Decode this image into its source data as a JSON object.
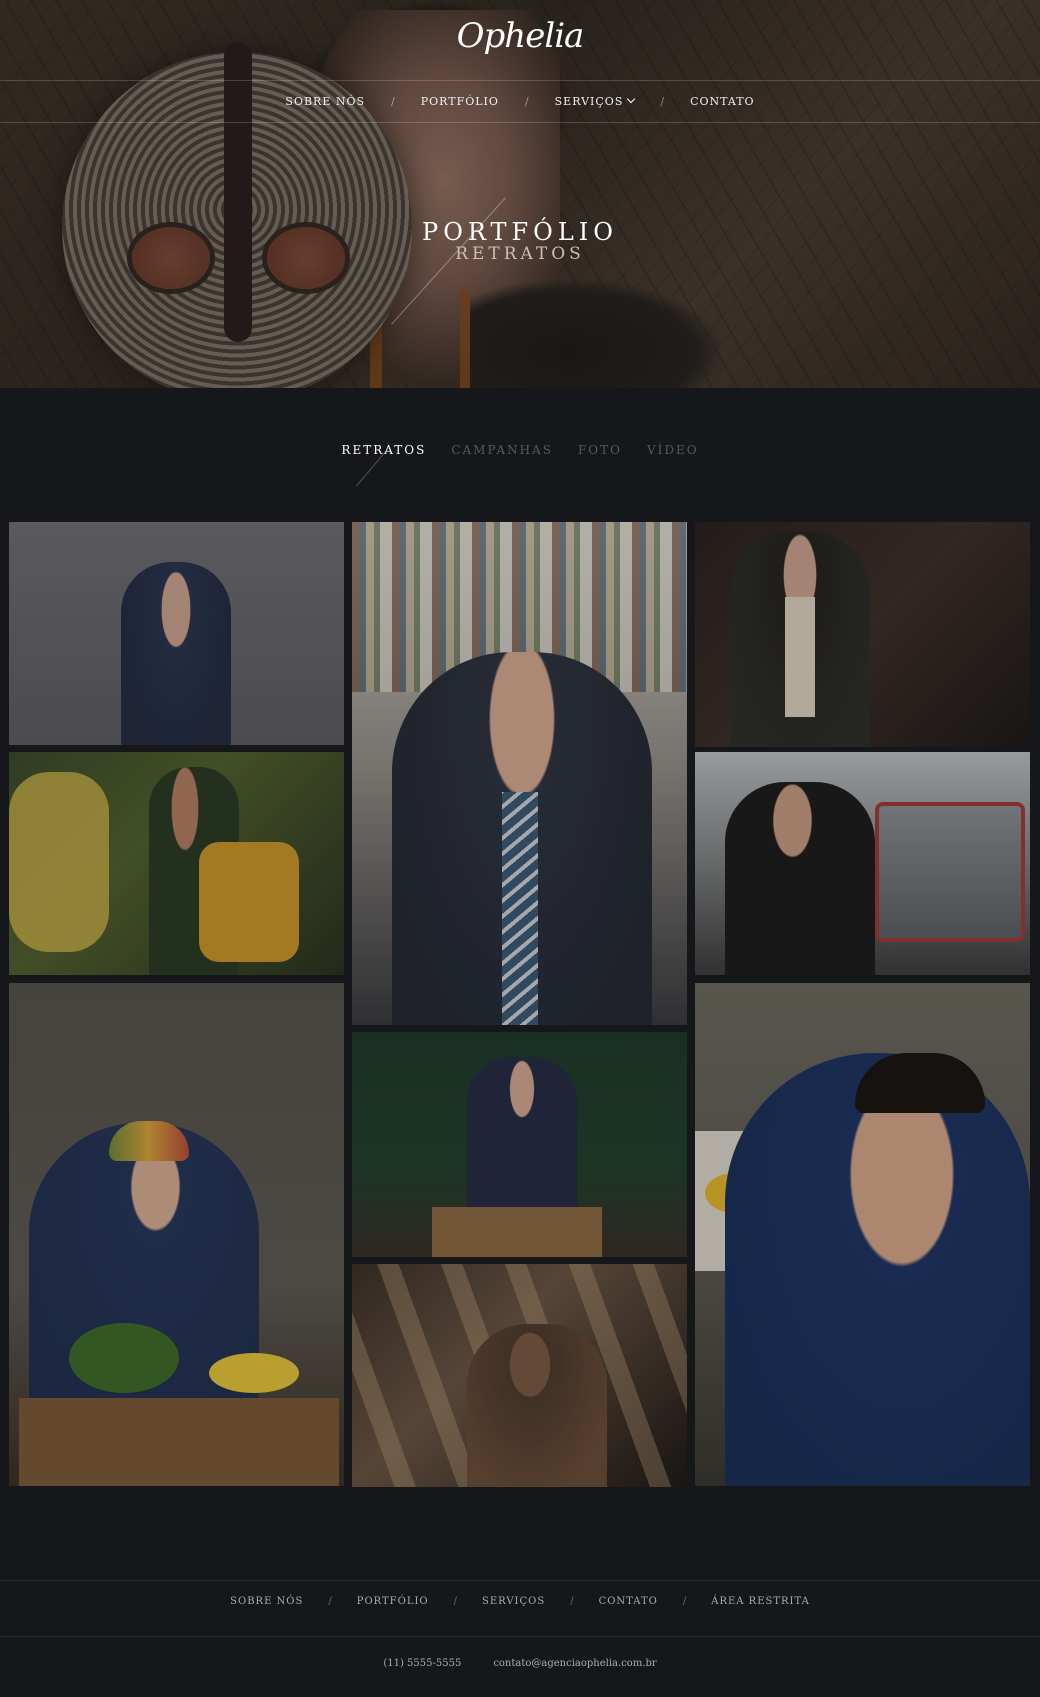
{
  "brand": {
    "logo_text": "Ophelia"
  },
  "nav": {
    "items": [
      {
        "label": "SOBRE NÓS"
      },
      {
        "label": "PORTFÓLIO"
      },
      {
        "label": "SERVIÇOS"
      },
      {
        "label": "CONTATO"
      }
    ],
    "separator": "/"
  },
  "hero": {
    "title": "PORTFÓLIO",
    "subtitle": "RETRATOS"
  },
  "filters": {
    "items": [
      {
        "label": "RETRATOS",
        "active": true
      },
      {
        "label": "CAMPANHAS",
        "active": false
      },
      {
        "label": "FOTO",
        "active": false
      },
      {
        "label": "VÍDEO",
        "active": false
      }
    ]
  },
  "footer": {
    "nav": [
      {
        "label": "SOBRE NÓS"
      },
      {
        "label": "PORTFÓLIO"
      },
      {
        "label": "SERVIÇOS"
      },
      {
        "label": "CONTATO"
      },
      {
        "label": "ÁREA RESTRITA"
      }
    ],
    "separator": "/",
    "phone": "(11) 5555-5555",
    "email": "contato@agenciaophelia.com.br"
  },
  "colors": {
    "background": "#15171a",
    "active_tab": "#ffffff",
    "inactive_tab": "#555a60"
  }
}
